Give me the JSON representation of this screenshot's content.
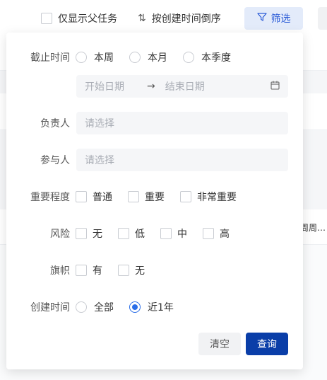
{
  "toolbar": {
    "parent_only_label": "仅显示父任务",
    "sort_label": "按创建时间倒序",
    "filter_label": "筛选",
    "sort_icon": "sort-icon",
    "filter_icon": "funnel-icon"
  },
  "background": {
    "partial_text": "周周…"
  },
  "filter": {
    "deadline": {
      "label": "截止时间",
      "options": [
        "本周",
        "本月",
        "本季度"
      ],
      "start_placeholder": "开始日期",
      "end_placeholder": "结束日期",
      "separator": "→"
    },
    "owner": {
      "label": "负责人",
      "placeholder": "请选择"
    },
    "participant": {
      "label": "参与人",
      "placeholder": "请选择"
    },
    "importance": {
      "label": "重要程度",
      "options": [
        "普通",
        "重要",
        "非常重要"
      ]
    },
    "risk": {
      "label": "风险",
      "options": [
        "无",
        "低",
        "中",
        "高"
      ]
    },
    "flag": {
      "label": "旗帜",
      "options": [
        "有",
        "无"
      ]
    },
    "created": {
      "label": "创建时间",
      "options": [
        "全部",
        "近1年"
      ],
      "selected": "近1年"
    },
    "clear_label": "清空",
    "query_label": "查询"
  },
  "colors": {
    "accent": "#0a3ea8",
    "radio_on": "#2a6ee8",
    "filter_bg": "#e3ebfa"
  }
}
